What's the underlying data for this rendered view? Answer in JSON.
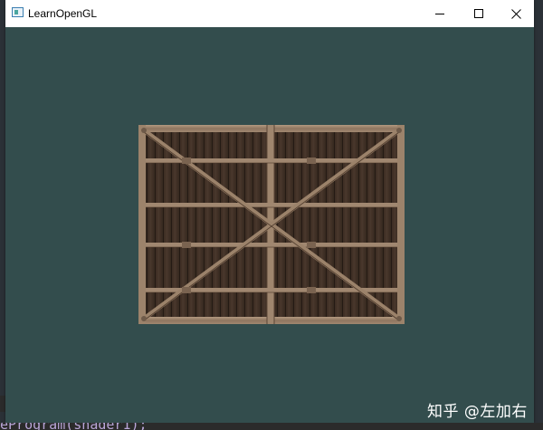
{
  "window": {
    "title": "LearnOpenGL",
    "controls": [
      "minimize-icon",
      "maximize-icon",
      "close-icon"
    ]
  },
  "viewport": {
    "clear_color": "#334d4d",
    "quad_texture": "wooden crate"
  },
  "watermark": "知乎 @左加右",
  "background_code": "eProgram(shader1);"
}
